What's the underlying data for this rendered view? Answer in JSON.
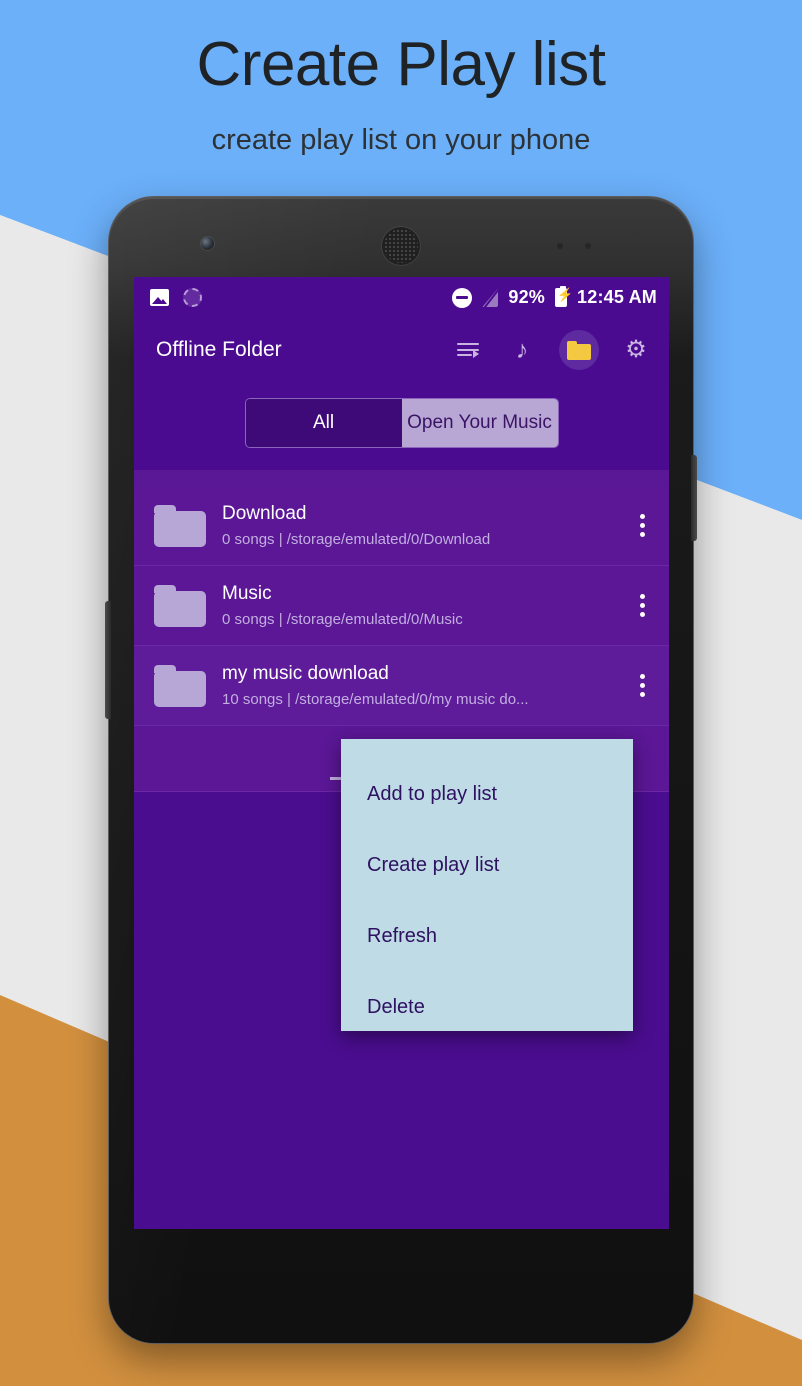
{
  "promo": {
    "headline": "Create Play list",
    "subhead": "create play list on your phone"
  },
  "colors": {
    "bg_blue": "#6cb0fa",
    "bg_gray": "#e9e9e9",
    "bg_orange": "#d2903f",
    "app_primary": "#4b0b90",
    "app_list": "#5b1796",
    "menu_bg": "#bedbe6",
    "menu_text": "#2e1160",
    "accent_folder": "#f5c842",
    "tab_selected_bg": "#b8a6d4"
  },
  "statusbar": {
    "left_icons": [
      "photo-icon",
      "sync-icon"
    ],
    "dnd_icon": "do-not-disturb-icon",
    "signal_icon": "signal-off-icon",
    "battery_percent": "92%",
    "battery_icon": "battery-charging-icon",
    "time": "12:45 AM"
  },
  "toolbar": {
    "title": "Offline Folder",
    "actions": [
      {
        "name": "queue-icon",
        "label": "Play queue"
      },
      {
        "name": "music-note-icon",
        "label": "Songs",
        "glyph": "♪"
      },
      {
        "name": "folder-icon",
        "label": "Folders",
        "active": true
      },
      {
        "name": "gear-icon",
        "label": "Settings",
        "glyph": "⚙"
      }
    ]
  },
  "tabs": {
    "items": [
      {
        "label": "All",
        "selected": false
      },
      {
        "label": "Open Your Music",
        "selected": true
      }
    ]
  },
  "folders": [
    {
      "name": "Download",
      "meta": "0 songs | /storage/emulated/0/Download"
    },
    {
      "name": "Music",
      "meta": "0 songs | /storage/emulated/0/Music"
    },
    {
      "name": "my music download",
      "meta": "10 songs | /storage/emulated/0/my music do..."
    }
  ],
  "context_menu": {
    "items": [
      {
        "label": "Add to play list"
      },
      {
        "label": "Create play list"
      },
      {
        "label": "Refresh"
      },
      {
        "label": "Delete"
      }
    ]
  }
}
